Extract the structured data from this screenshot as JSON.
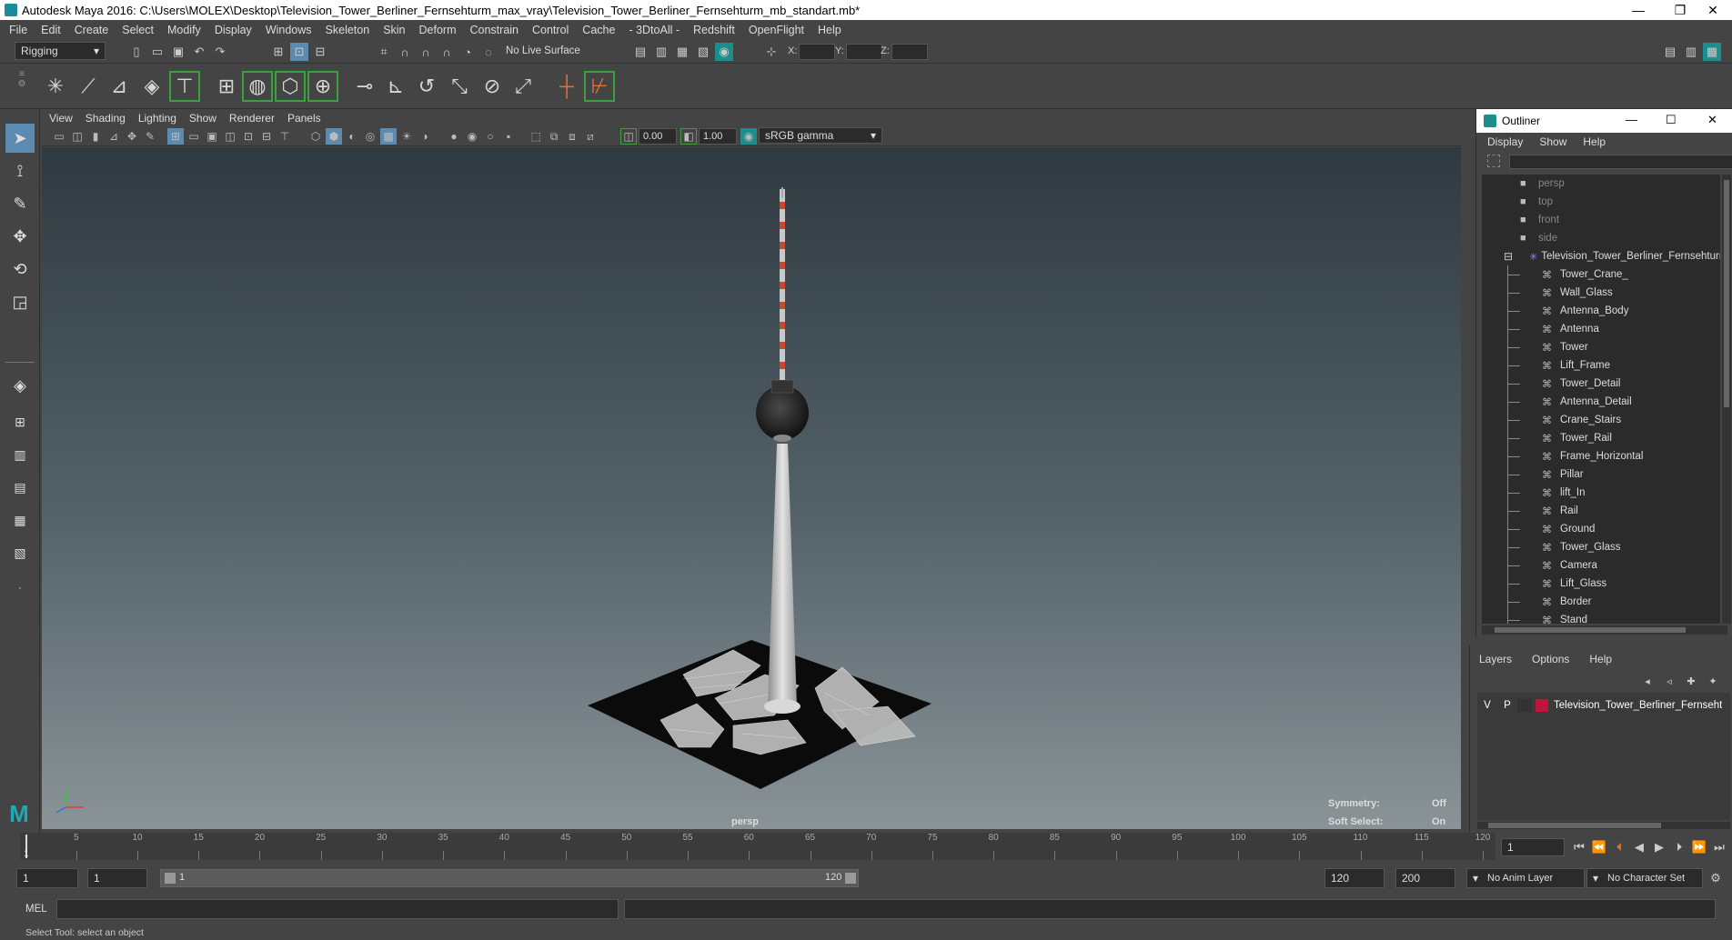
{
  "window": {
    "title": "Autodesk Maya 2016: C:\\Users\\MOLEX\\Desktop\\Television_Tower_Berliner_Fernsehturm_max_vray\\Television_Tower_Berliner_Fernsehturm_mb_standart.mb*",
    "minimize": "—",
    "restore": "❐",
    "close": "✕"
  },
  "menubar": [
    "File",
    "Edit",
    "Create",
    "Select",
    "Modify",
    "Display",
    "Windows",
    "Skeleton",
    "Skin",
    "Deform",
    "Constrain",
    "Control",
    "Cache",
    "- 3DtoAll -",
    "Redshift",
    "OpenFlight",
    "Help"
  ],
  "statusline": {
    "menuset": "Rigging",
    "live_surface": "No Live Surface",
    "x_label": "X:",
    "y_label": "Y:",
    "z_label": "Z:"
  },
  "panel": {
    "menus": [
      "View",
      "Shading",
      "Lighting",
      "Show",
      "Renderer",
      "Panels"
    ],
    "exposure": "0.00",
    "gamma": "1.00",
    "colorspace": "sRGB gamma"
  },
  "viewport": {
    "camera": "persp",
    "symmetry_label": "Symmetry:",
    "symmetry_value": "Off",
    "softselect_label": "Soft Select:",
    "softselect_value": "On"
  },
  "outliner": {
    "title": "Outliner",
    "menus": [
      "Display",
      "Show",
      "Help"
    ],
    "cameras": [
      "persp",
      "top",
      "front",
      "side"
    ],
    "root": "Television_Tower_Berliner_Fernsehturm_",
    "children": [
      "Tower_Crane_",
      "Wall_Glass",
      "Antenna_Body",
      "Antenna",
      "Tower",
      "Lift_Frame",
      "Tower_Detail",
      "Antenna_Detail",
      "Crane_Stairs",
      "Tower_Rail",
      "Frame_Horizontal",
      "Pillar",
      "lift_In",
      "Rail",
      "Ground",
      "Tower_Glass",
      "Camera",
      "Lift_Glass",
      "Border",
      "Stand"
    ]
  },
  "layers": {
    "menus": [
      "Layers",
      "Options",
      "Help"
    ],
    "row": {
      "v": "V",
      "p": "P",
      "name": "Television_Tower_Berliner_Fernseht",
      "color": "#c0143c"
    }
  },
  "timeline": {
    "ticks": [
      "5",
      "10",
      "15",
      "20",
      "25",
      "30",
      "35",
      "40",
      "45",
      "50",
      "55",
      "60",
      "65",
      "70",
      "75",
      "80",
      "85",
      "90",
      "95",
      "100",
      "105",
      "110",
      "115",
      "120"
    ],
    "current_frame": "1",
    "first_marker": "1"
  },
  "range": {
    "start": "1",
    "playback_start": "1",
    "slider_start": "1",
    "slider_end": "120",
    "playback_end": "120",
    "end": "200",
    "anim_layer": "No Anim Layer",
    "char_set": "No Character Set"
  },
  "command": {
    "mel": "MEL"
  },
  "help": "Select Tool: select an object"
}
